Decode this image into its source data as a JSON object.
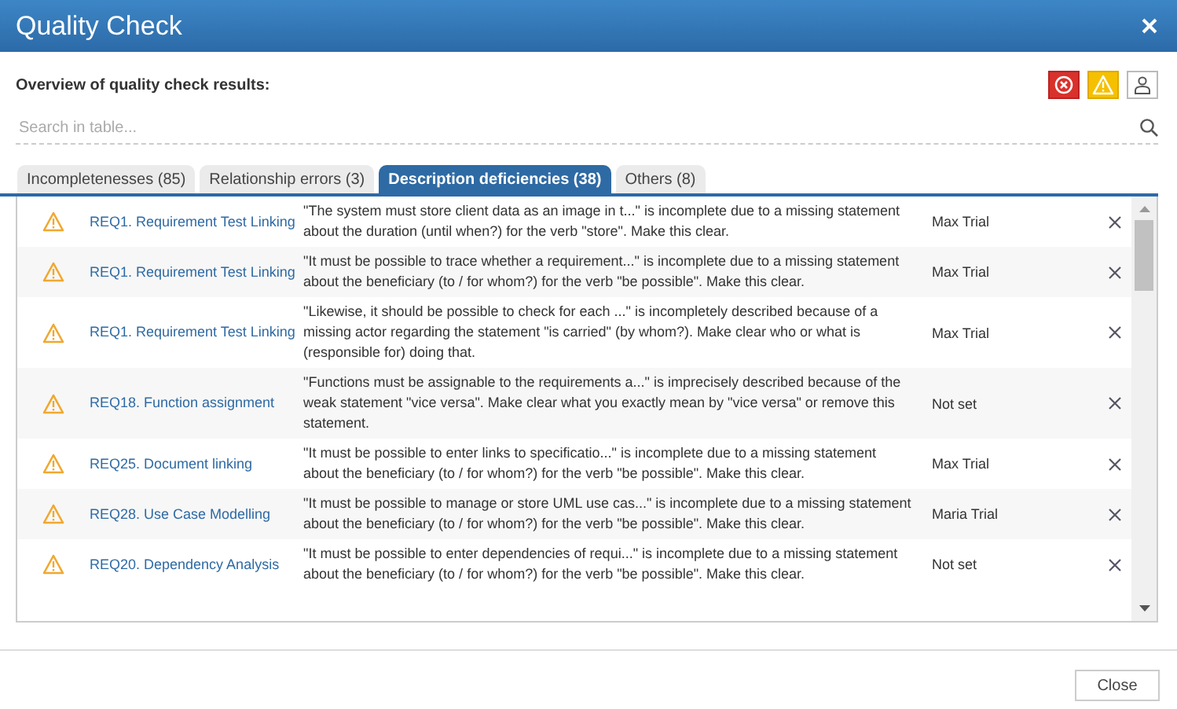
{
  "window": {
    "title": "Quality Check"
  },
  "overview_label": "Overview of quality check results:",
  "filters": [
    {
      "kind": "error",
      "on": true
    },
    {
      "kind": "warning",
      "on": true
    },
    {
      "kind": "user",
      "on": false
    }
  ],
  "search": {
    "placeholder": "Search in table..."
  },
  "tabs": [
    {
      "label": "Incompletenesses (85)",
      "selected": false
    },
    {
      "label": "Relationship errors (3)",
      "selected": false
    },
    {
      "label": "Description deficiencies (38)",
      "selected": true
    },
    {
      "label": "Others (8)",
      "selected": false
    }
  ],
  "rows": [
    {
      "requirement": "REQ1. Requirement Test Linking",
      "description": "\"The system must store client data as an image in t...\" is incomplete due to a missing statement about the duration (until when?) for the verb \"store\". Make this clear.",
      "assignee": "Max Trial"
    },
    {
      "requirement": "REQ1. Requirement Test Linking",
      "description": "\"It must be possible to trace whether a requirement...\" is incomplete due to a missing statement about the beneficiary (to / for whom?) for the verb \"be possible\". Make this clear.",
      "assignee": "Max Trial"
    },
    {
      "requirement": "REQ1. Requirement Test Linking",
      "description": "\"Likewise, it should be possible to check for each ...\" is incompletely described because of a missing actor regarding the statement \"is carried\" (by whom?). Make clear who or what is (responsible for) doing that.",
      "assignee": "Max Trial"
    },
    {
      "requirement": "REQ18. Function assignment",
      "description": "\"Functions must be assignable to the requirements a...\" is imprecisely described because of the weak statement \"vice versa\". Make clear what you exactly mean by \"vice versa\" or remove this statement.",
      "assignee": "Not set"
    },
    {
      "requirement": "REQ25. Document linking",
      "description": "\"It must be possible to enter links to specificatio...\" is incomplete due to a missing statement about the beneficiary (to / for whom?) for the verb \"be possible\". Make this clear.",
      "assignee": "Max Trial"
    },
    {
      "requirement": "REQ28. Use Case Modelling",
      "description": "\"It must be possible to manage or store UML use cas...\" is incomplete due to a missing statement about the beneficiary (to / for whom?) for the verb \"be possible\". Make this clear.",
      "assignee": "Maria Trial"
    },
    {
      "requirement": "REQ20. Dependency Analysis",
      "description": "\"It must be possible to enter dependencies of requi...\" is incomplete due to a missing statement about the beneficiary (to / for whom?) for the verb \"be possible\". Make this clear.",
      "assignee": "Not set"
    }
  ],
  "buttons": [
    {
      "label": "Close"
    }
  ]
}
